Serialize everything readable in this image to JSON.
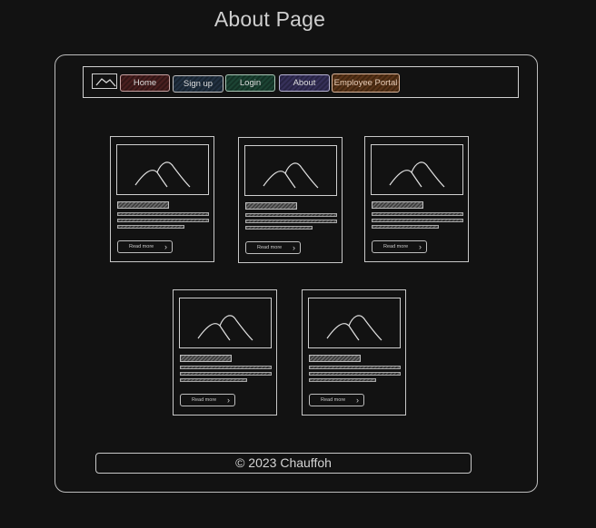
{
  "page": {
    "title": "About Page"
  },
  "navbar": {
    "items": [
      {
        "label": "Home"
      },
      {
        "label": "Sign up"
      },
      {
        "label": "Login"
      },
      {
        "label": "About"
      },
      {
        "label": "Employee Portal"
      }
    ]
  },
  "cards": [
    {
      "read_more": "Read more"
    },
    {
      "read_more": "Read more"
    },
    {
      "read_more": "Read more"
    },
    {
      "read_more": "Read more"
    },
    {
      "read_more": "Read more"
    }
  ],
  "footer": {
    "text": "© 2023 Chauffoh"
  },
  "icons": {
    "logo": "mountain-logo-icon",
    "card_image": "image-placeholder-icon",
    "read_more": "chevron-right-icon"
  }
}
